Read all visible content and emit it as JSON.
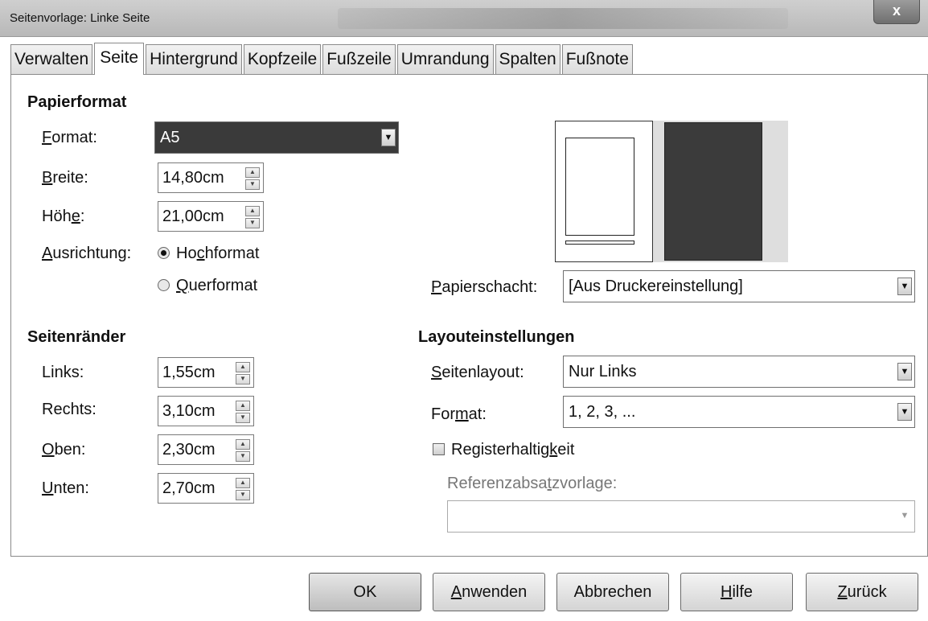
{
  "window": {
    "title": "Seitenvorlage: Linke Seite",
    "close_label": "x"
  },
  "tabs": [
    {
      "label": "Verwalten"
    },
    {
      "label": "Seite"
    },
    {
      "label": "Hintergrund"
    },
    {
      "label": "Kopfzeile"
    },
    {
      "label": "Fußzeile"
    },
    {
      "label": "Umrandung"
    },
    {
      "label": "Spalten"
    },
    {
      "label": "Fußnote"
    }
  ],
  "paper_format": {
    "section_title": "Papierformat",
    "format_label_key": "F",
    "format_label_rest": "ormat:",
    "format_value": "A5",
    "width_label_key": "B",
    "width_label_rest": "reite:",
    "width_value": "14,80cm",
    "height_label_pre": "Höh",
    "height_label_key": "e",
    "height_label_rest": ":",
    "height_value": "21,00cm",
    "orientation_label_key": "A",
    "orientation_label_rest": "usrichtung:",
    "portrait_pre": "Ho",
    "portrait_key": "c",
    "portrait_rest": "hformat",
    "landscape_key": "Q",
    "landscape_rest": "uerformat",
    "tray_label_key": "P",
    "tray_label_rest": "apierschacht:",
    "tray_value": "[Aus Druckereinstellung]"
  },
  "margins": {
    "section_title": "Seitenränder",
    "left_label": "Links:",
    "left_value": "1,55cm",
    "right_label": "Rechts:",
    "right_value": "3,10cm",
    "top_label_key": "O",
    "top_label_rest": "ben:",
    "top_value": "2,30cm",
    "bottom_label_key": "U",
    "bottom_label_rest": "nten:",
    "bottom_value": "2,70cm"
  },
  "layout": {
    "section_title": "Layouteinstellungen",
    "page_layout_label_key": "S",
    "page_layout_label_rest": "eitenlayout:",
    "page_layout_value": "Nur Links",
    "format_label_pre": "For",
    "format_label_key": "m",
    "format_label_rest": "at:",
    "format_value": "1, 2, 3, ...",
    "register_pre": "Registerhaltig",
    "register_key": "k",
    "register_rest": "eit",
    "ref_style_pre": "Referenzabsa",
    "ref_style_key": "t",
    "ref_style_rest": "zvorlage:",
    "ref_style_value": ""
  },
  "buttons": {
    "ok": "OK",
    "apply_key": "A",
    "apply_rest": "nwenden",
    "cancel": "Abbrechen",
    "help_key": "H",
    "help_rest": "ilfe",
    "back_key": "Z",
    "back_rest": "urück"
  }
}
